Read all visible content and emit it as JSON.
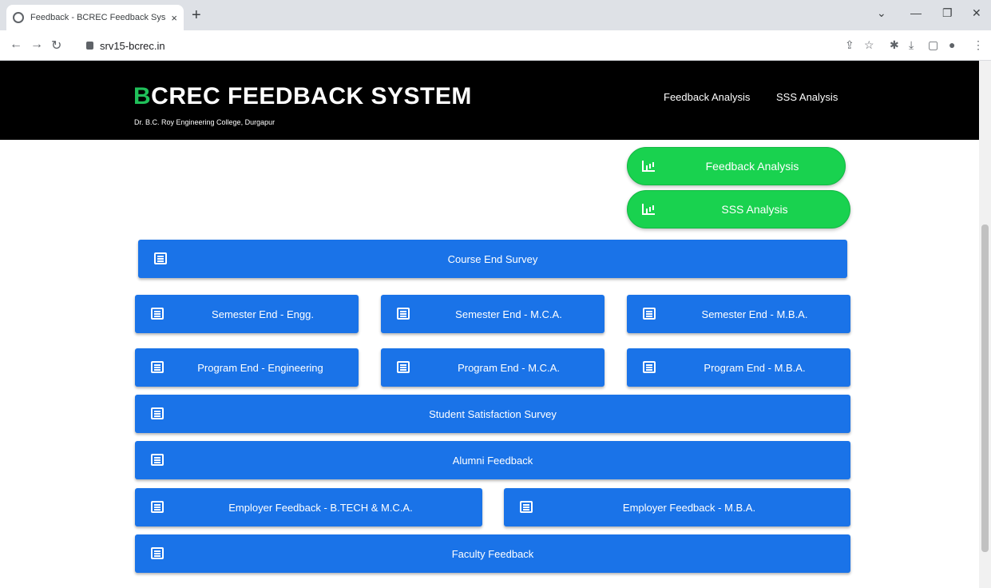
{
  "browser": {
    "tab_title": "Feedback - BCREC Feedback Sys",
    "tab_close": "×",
    "new_tab": "+",
    "url": "srv15-bcrec.in"
  },
  "header": {
    "brand_initial": "B",
    "brand_rest": "CREC FEEDBACK SYSTEM",
    "subtitle": "Dr. B.C. Roy Engineering College, Durgapur",
    "nav": [
      "Feedback Analysis",
      "SSS Analysis"
    ]
  },
  "analysis_buttons": [
    "Feedback Analysis",
    "SSS Analysis"
  ],
  "survey_buttons": {
    "course_end": "Course End Survey",
    "semester_engg": "Semester End - Engg.",
    "semester_mca": "Semester End - M.C.A.",
    "semester_mba": "Semester End - M.B.A.",
    "program_engg": "Program End - Engineering",
    "program_mca": "Program End - M.C.A.",
    "program_mba": "Program End - M.B.A.",
    "student_satisfaction": "Student Satisfaction Survey",
    "alumni": "Alumni Feedback",
    "employer_btech_mca": "Employer Feedback - B.TECH & M.C.A.",
    "employer_mba": "Employer Feedback - M.B.A.",
    "faculty": "Faculty Feedback"
  },
  "colors": {
    "header_bg": "#000000",
    "brand_accent": "#20c05a",
    "green_button": "#19d24f",
    "blue_button": "#1a73e8"
  },
  "icons": {
    "analysis": "bar-chart-icon",
    "survey": "list-icon"
  }
}
